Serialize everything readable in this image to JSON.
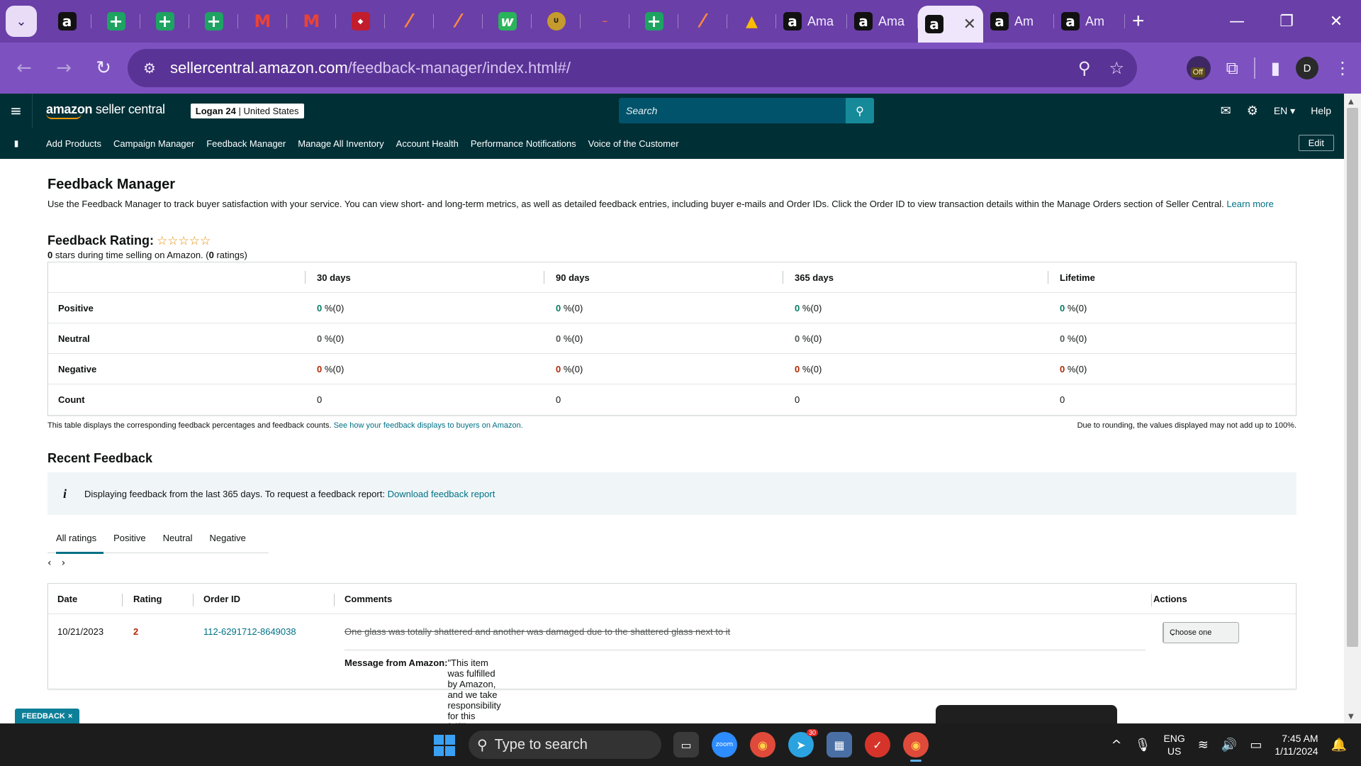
{
  "browser": {
    "tabs": [
      {
        "favicon": "amazon-icon",
        "label": ""
      },
      {
        "favicon": "plus-icon",
        "label": ""
      },
      {
        "favicon": "plus-icon",
        "label": ""
      },
      {
        "favicon": "plus-icon",
        "label": ""
      },
      {
        "favicon": "gmail-icon",
        "label": ""
      },
      {
        "favicon": "gmail-icon",
        "label": ""
      },
      {
        "favicon": "red-logo-icon",
        "label": ""
      },
      {
        "favicon": "slash-icon",
        "label": ""
      },
      {
        "favicon": "slash-icon",
        "label": ""
      },
      {
        "favicon": "w-logo-icon",
        "label": ""
      },
      {
        "favicon": "uline-icon",
        "label": ""
      },
      {
        "favicon": "small-logo-icon",
        "label": ""
      },
      {
        "favicon": "plus-icon",
        "label": ""
      },
      {
        "favicon": "slash-icon",
        "label": ""
      },
      {
        "favicon": "drive-icon",
        "label": ""
      },
      {
        "favicon": "amazon-icon",
        "label": "Ama"
      },
      {
        "favicon": "amazon-icon",
        "label": "Ama"
      },
      {
        "favicon": "amazon-icon",
        "label": "",
        "active": true
      },
      {
        "favicon": "amazon-icon",
        "label": "Am"
      },
      {
        "favicon": "amazon-icon",
        "label": "Am"
      }
    ],
    "url_domain": "sellercentral.amazon.com",
    "url_path": "/feedback-manager/index.html#/",
    "extension_badge": "Off",
    "profile_initial": "D"
  },
  "header": {
    "logo_bold": "amazon",
    "logo_rest": " seller central",
    "store_name": "Logan 24",
    "store_region": " | United States",
    "search_placeholder": "Search",
    "language": "EN",
    "help": "Help"
  },
  "nav": {
    "links": [
      "Add Products",
      "Campaign Manager",
      "Feedback Manager",
      "Manage All Inventory",
      "Account Health",
      "Performance Notifications",
      "Voice of the Customer"
    ],
    "edit": "Edit"
  },
  "page": {
    "title": "Feedback Manager",
    "description": "Use the Feedback Manager to track buyer satisfaction with your service. You can view short- and long-term metrics, as well as detailed feedback entries, including buyer e-mails and Order IDs. Click the Order ID to view transaction details within the Manage Orders section of Seller Central. ",
    "learn_more": "Learn more",
    "rating_title": "Feedback Rating:",
    "stars_display": "☆☆☆☆☆",
    "rating_stars_value": "0",
    "rating_sub_mid": " stars during time selling on Amazon. (",
    "rating_count": "0",
    "rating_sub_end": " ratings)"
  },
  "metrics": {
    "columns": [
      "30 days",
      "90 days",
      "365 days",
      "Lifetime"
    ],
    "rows": [
      {
        "label": "Positive",
        "kind": "green",
        "values": [
          "0",
          "0",
          "0",
          "0"
        ],
        "suffix": " %(0)"
      },
      {
        "label": "Neutral",
        "kind": "plain",
        "values": [
          "0",
          "0",
          "0",
          "0"
        ],
        "suffix": " %(0)"
      },
      {
        "label": "Negative",
        "kind": "red",
        "values": [
          "0",
          "0",
          "0",
          "0"
        ],
        "suffix": " %(0)"
      },
      {
        "label": "Count",
        "kind": "count",
        "values": [
          "0",
          "0",
          "0",
          "0"
        ],
        "suffix": ""
      }
    ],
    "note": "This table displays the corresponding feedback percentages and feedback counts. ",
    "note_link": "See how your feedback displays to buyers on Amazon.",
    "note_right": "Due to rounding, the values displayed may not add up to 100%."
  },
  "recent": {
    "title": "Recent Feedback",
    "info_text": "Displaying feedback from the last 365 days. To request a feedback report: ",
    "info_link": "Download feedback report",
    "tabs": [
      "All ratings",
      "Positive",
      "Neutral",
      "Negative"
    ],
    "columns": [
      "Date",
      "Rating",
      "Order ID",
      "Comments",
      "Actions"
    ],
    "rows": [
      {
        "date": "10/21/2023",
        "rating": "2",
        "order_id": "112-6291712-8649038",
        "comment": "One glass was totally shattered and another was damaged due to the shattered glass next to it",
        "message_label": "Message from Amazon:",
        "message": " \"This item was fulfilled by Amazon, and we take responsibility for this fulfillment experience.\"",
        "action": "Choose one"
      }
    ]
  },
  "feedback_tab": "FEEDBACK",
  "taskbar": {
    "search_placeholder": "Type to search",
    "telegram_badge": "30",
    "lang_top": "ENG",
    "lang_bottom": "US",
    "time": "7:45 AM",
    "date": "1/11/2024"
  },
  "colors": {
    "browser_tabbar": "#6a3fa8",
    "seller_header": "#002f36",
    "link": "#007185",
    "positive": "#067d62",
    "negative": "#b12704"
  }
}
